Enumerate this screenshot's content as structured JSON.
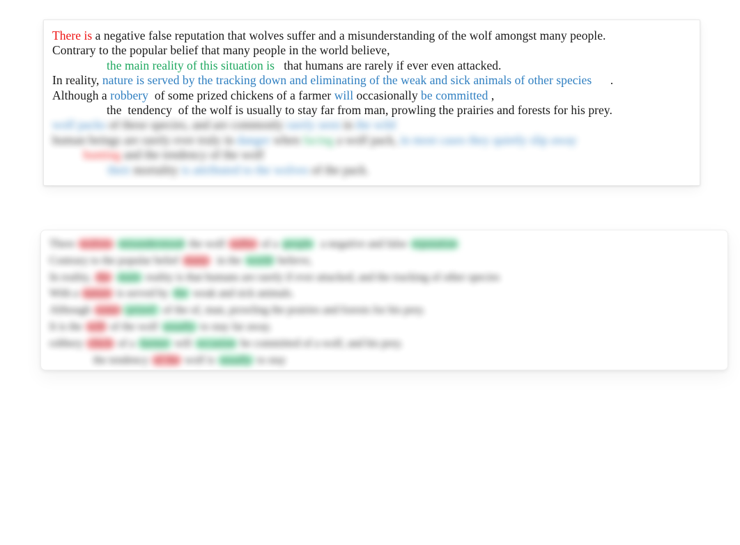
{
  "document": {
    "primary_panel": {
      "name": "text-proofreading-panel",
      "lines": [
        {
          "id": "line-1",
          "segments": [
            {
              "text": "There is",
              "style": "red"
            },
            {
              "text": " a negative false reputation that wolves suffer and a misunderstanding of the wolf amongst many people.",
              "style": "plain"
            }
          ]
        },
        {
          "id": "line-2",
          "segments": [
            {
              "text": "Contrary to the popular belief that many people in the world believe,",
              "style": "plain"
            }
          ]
        },
        {
          "id": "line-3",
          "indent": true,
          "segments": [
            {
              "text": "the main reality of this situation is",
              "style": "green"
            },
            {
              "text": "   that humans are rarely if ever even attacked.",
              "style": "plain"
            }
          ]
        },
        {
          "id": "line-4",
          "segments": [
            {
              "text": "In reality, ",
              "style": "plain"
            },
            {
              "text": "nature is served by the tracking down and eliminating of the weak and sick animals of other species",
              "style": "blue"
            },
            {
              "text": "      .",
              "style": "plain"
            }
          ]
        },
        {
          "id": "line-5",
          "segments": [
            {
              "text": "Although a ",
              "style": "plain"
            },
            {
              "text": "robbery",
              "style": "blue"
            },
            {
              "text": "  of some prized chickens of a farmer ",
              "style": "plain"
            },
            {
              "text": "will",
              "style": "blue"
            },
            {
              "text": " occasionally ",
              "style": "plain"
            },
            {
              "text": "be committed",
              "style": "blue"
            },
            {
              "text": " ,",
              "style": "plain"
            }
          ]
        },
        {
          "id": "line-6",
          "indent": true,
          "segments": [
            {
              "text": "the  tendency  of the wolf is usually to stay far from man, prowling the prairies and forests for his prey.",
              "style": "plain"
            }
          ]
        }
      ],
      "blurred_tail_lines": [
        {
          "id": "line-7",
          "segments": [
            {
              "text": "wolf packs",
              "style": "blue"
            },
            {
              "text": " of these species, and are commonly ",
              "style": "plain"
            },
            {
              "text": "rarely seen",
              "style": "blue"
            },
            {
              "text": " in ",
              "style": "plain"
            },
            {
              "text": "the wild",
              "style": "blue"
            }
          ]
        },
        {
          "id": "line-8",
          "segments": [
            {
              "text": "human beings are rarely ever truly in ",
              "style": "plain"
            },
            {
              "text": "danger",
              "style": "blue"
            },
            {
              "text": " when ",
              "style": "plain"
            },
            {
              "text": "facing",
              "style": "green"
            },
            {
              "text": " a wolf pack, ",
              "style": "plain"
            },
            {
              "text": "in most cases they quietly slip away",
              "style": "blue"
            }
          ]
        },
        {
          "id": "line-9",
          "segments": [
            {
              "text": "          ",
              "style": "plain"
            },
            {
              "text": "hunting",
              "style": "red"
            },
            {
              "text": " and the tendency of the wolf",
              "style": "plain"
            }
          ]
        },
        {
          "id": "line-10",
          "segments": [
            {
              "text": "                  ",
              "style": "plain"
            },
            {
              "text": "their",
              "style": "blue"
            },
            {
              "text": " mortality ",
              "style": "plain"
            },
            {
              "text": "is attributed to the wolves",
              "style": "blue"
            },
            {
              "text": " of the pack.",
              "style": "plain"
            }
          ]
        }
      ]
    },
    "secondary_panel": {
      "name": "blurred-comparison-panel",
      "lines": [
        {
          "id": "blur-line-1",
          "segments": [
            {
              "text": "There ",
              "style": "plain"
            },
            {
              "text": "wolves",
              "style": "hl-red"
            },
            {
              "text": " ",
              "style": "plain"
            },
            {
              "text": "misunderstood",
              "style": "hl-green"
            },
            {
              "text": " the wolf ",
              "style": "plain"
            },
            {
              "text": "suffer",
              "style": "hl-red"
            },
            {
              "text": " of a ",
              "style": "plain"
            },
            {
              "text": "people",
              "style": "hl-green"
            },
            {
              "text": "  a negative and false ",
              "style": "plain"
            },
            {
              "text": "reputation",
              "style": "hl-green"
            }
          ]
        },
        {
          "id": "blur-line-2",
          "segments": [
            {
              "text": "Contrary to the popular belief ",
              "style": "plain"
            },
            {
              "text": "many",
              "style": "hl-red"
            },
            {
              "text": "  in the ",
              "style": "plain"
            },
            {
              "text": "world",
              "style": "hl-green"
            },
            {
              "text": " believe,",
              "style": "plain"
            }
          ]
        },
        {
          "id": "blur-line-3",
          "segments": [
            {
              "text": "In reality, ",
              "style": "plain"
            },
            {
              "text": "the",
              "style": "hl-red"
            },
            {
              "text": " ",
              "style": "plain"
            },
            {
              "text": "main",
              "style": "hl-green"
            },
            {
              "text": " reality is that humans are rarely if ever attacked, and the tracking of other species",
              "style": "plain"
            }
          ]
        },
        {
          "id": "blur-line-4",
          "segments": [
            {
              "text": "With a ",
              "style": "plain"
            },
            {
              "text": "nature",
              "style": "hl-red"
            },
            {
              "text": " is served by ",
              "style": "plain"
            },
            {
              "text": "the",
              "style": "hl-green"
            },
            {
              "text": " weak and sick animals.",
              "style": "plain"
            }
          ]
        },
        {
          "id": "blur-line-5",
          "segments": [
            {
              "text": "Although ",
              "style": "plain"
            },
            {
              "text": "some",
              "style": "hl-red"
            },
            {
              "text": " prized ",
              "style": "hl-green"
            },
            {
              "text": " of the of, man, prowling the prairies and forests for his prey.",
              "style": "plain"
            }
          ]
        },
        {
          "id": "blur-line-6",
          "segments": [
            {
              "text": "It is the ",
              "style": "plain"
            },
            {
              "text": "will",
              "style": "hl-red"
            },
            {
              "text": " of the wolf ",
              "style": "plain"
            },
            {
              "text": "usually",
              "style": "hl-green"
            },
            {
              "text": " to stay far away.",
              "style": "plain"
            }
          ]
        },
        {
          "id": "blur-line-7",
          "segments": [
            {
              "text": "robbery ",
              "style": "plain"
            },
            {
              "text": "chick",
              "style": "hl-red"
            },
            {
              "text": " of a ",
              "style": "plain"
            },
            {
              "text": "farmer",
              "style": "hl-green"
            },
            {
              "text": " will ",
              "style": "plain"
            },
            {
              "text": "occasion",
              "style": "hl-green"
            },
            {
              "text": " be committed of a wolf, and his prey.",
              "style": "plain"
            }
          ]
        },
        {
          "id": "blur-line-8",
          "segments": [
            {
              "text": "                ",
              "style": "plain"
            },
            {
              "text": "the tendency ",
              "style": "plain"
            },
            {
              "text": "of the",
              "style": "hl-red"
            },
            {
              "text": " wolf is ",
              "style": "plain"
            },
            {
              "text": "usually",
              "style": "hl-green"
            },
            {
              "text": " to stay",
              "style": "plain"
            }
          ]
        }
      ]
    }
  },
  "colors": {
    "text_red": "#ee1111",
    "text_green": "#1fa860",
    "text_blue": "#2f7fc1",
    "text_plain": "#1a1a1a",
    "highlight_red": "#f9a9ad",
    "highlight_green": "#a8ebc8",
    "page_background": "#ffffff",
    "card_background": "#ffffff"
  }
}
